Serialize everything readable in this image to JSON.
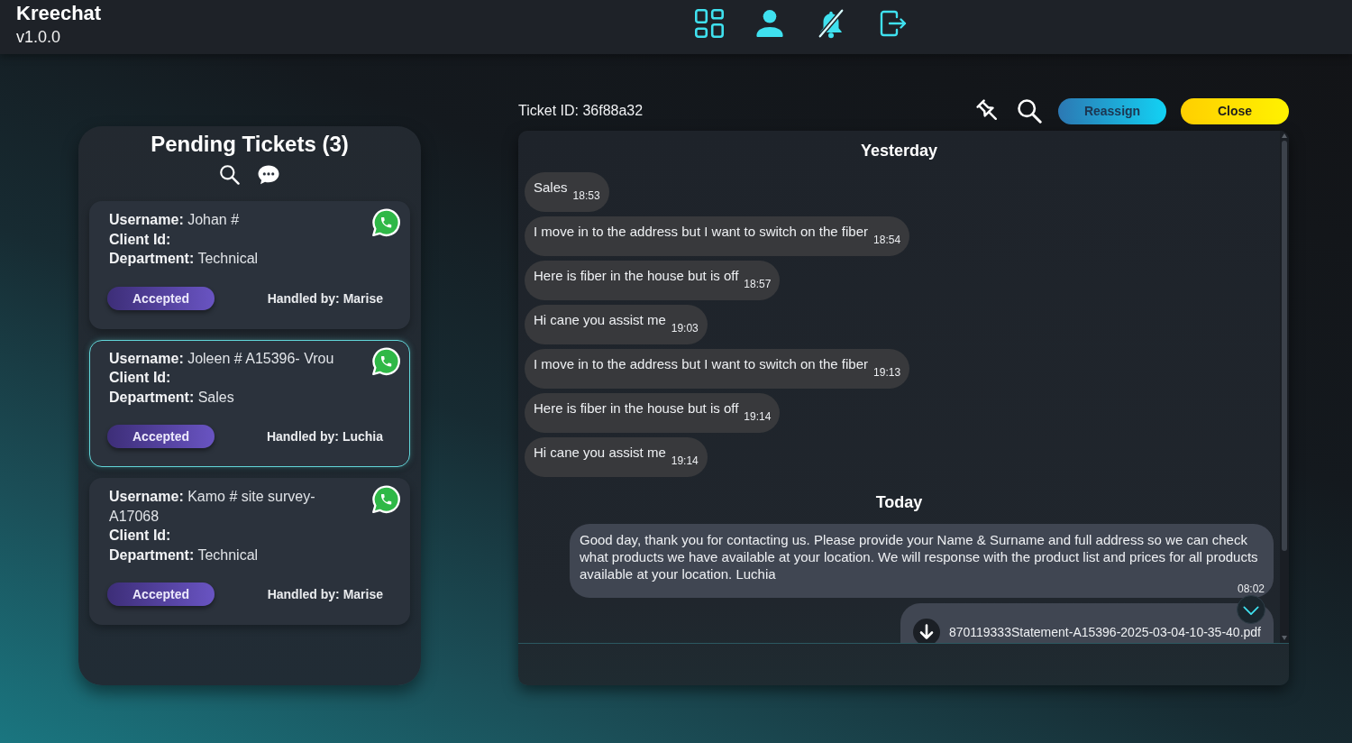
{
  "header": {
    "app_name": "Kreechat",
    "version": "v1.0.0",
    "notifications_muted": true
  },
  "tickets_panel": {
    "title": "Pending Tickets (3)",
    "tickets": [
      {
        "fields": [
          {
            "label": "Username:",
            "value": "Johan #"
          },
          {
            "label": "Client Id:"
          },
          {
            "label": "Department:",
            "value": "Technical"
          }
        ],
        "status": "Accepted",
        "handler": "Handled by: Marise",
        "selected": false
      },
      {
        "fields": [
          {
            "label": "Username:",
            "value": "Joleen # A15396- Vrou"
          },
          {
            "label": "Client Id:"
          },
          {
            "label": "Department:",
            "value": "Sales"
          }
        ],
        "status": "Accepted",
        "handler": "Handled by: Luchia",
        "selected": true
      },
      {
        "fields": [
          {
            "label": "Username:",
            "value": "Kamo # site survey-A17068"
          },
          {
            "label": "Client Id:"
          },
          {
            "label": "Department:",
            "value": "Technical"
          }
        ],
        "status": "Accepted",
        "handler": "Handled by: Marise",
        "selected": false
      }
    ]
  },
  "chat": {
    "ticket_id": "Ticket ID: 36f88a32",
    "buttons": [
      {
        "label": "Reassign",
        "kind": "reassign"
      },
      {
        "label": "Close",
        "kind": "close"
      }
    ],
    "groups": [
      {
        "date": "Yesterday",
        "messages": [
          {
            "kind": "incoming",
            "text": "Sales",
            "time": "18:53"
          },
          {
            "kind": "incoming",
            "text": "I move in to the address but I want to switch on the fiber",
            "time": "18:54"
          },
          {
            "kind": "incoming",
            "text": "Here is fiber in the house but is off",
            "time": "18:57"
          },
          {
            "kind": "incoming",
            "text": "Hi cane you assist me",
            "time": "19:03"
          },
          {
            "kind": "incoming",
            "text": "I move in to the address but I want to switch on the fiber",
            "time": "19:13"
          },
          {
            "kind": "incoming",
            "text": "Here is fiber in the house but is off",
            "time": "19:14"
          },
          {
            "kind": "incoming",
            "text": "Hi cane you assist me",
            "time": "19:14"
          }
        ]
      },
      {
        "date": "Today",
        "messages": [
          {
            "kind": "outgoing",
            "text": "Good day, thank you for contacting us. Please provide your Name & Surname and full address so we can check what products we have available at your location. We will response with the product list and prices for all products available at your location. Luchia",
            "time": "08:02"
          },
          {
            "kind": "attachment",
            "file_name": "870119333Statement-A15396-2025-03-04-10-35-40.pdf"
          }
        ]
      }
    ]
  }
}
